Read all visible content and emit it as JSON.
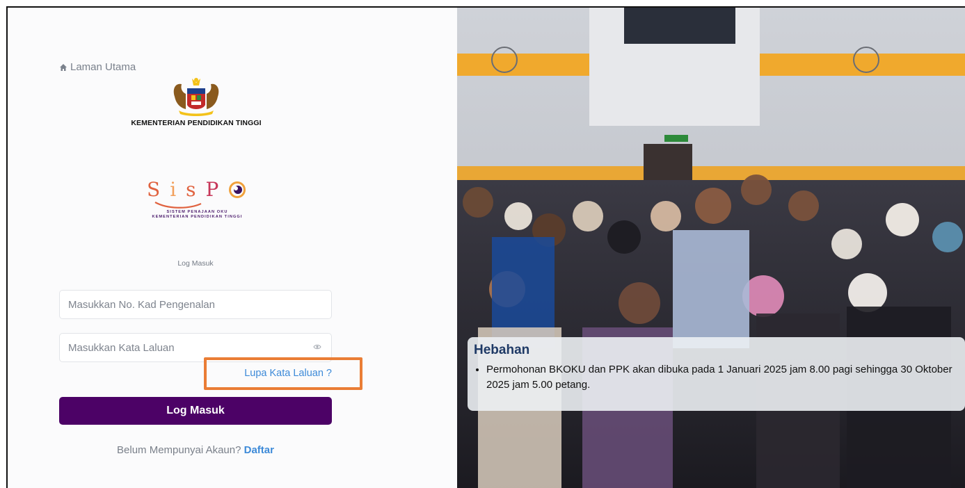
{
  "left": {
    "home_link": "Laman Utama",
    "ministry_name": "KEMENTERIAN PENDIDIKAN TINGGI",
    "logo": {
      "word": "SisPO",
      "tagline_1": "SISTEM PENAJAAN OKU",
      "tagline_2": "KEMENTERIAN PENDIDIKAN TINGGI"
    },
    "login_title": "Log Masuk",
    "ic_placeholder": "Masukkan No. Kad Pengenalan",
    "password_placeholder": "Masukkan Kata Laluan",
    "forgot_password": "Lupa Kata Laluan ?",
    "login_button": "Log Masuk",
    "signup_prompt": "Belum Mempunyai Akaun?",
    "signup_link": "Daftar"
  },
  "right": {
    "announcement_title": "Hebahan",
    "announcement_items": [
      "Permohonan BKOKU dan PPK akan dibuka pada 1 Januari 2025 jam 8.00 pagi sehingga 30 Oktober 2025 jam 5.00 petang."
    ]
  },
  "colors": {
    "primary": "#4c0266",
    "link": "#3d8ad8",
    "highlight_box": "#ea7d35",
    "announcement_title": "#1f3a66"
  },
  "icons": [
    "home-icon",
    "government-crest",
    "eye-icon"
  ]
}
